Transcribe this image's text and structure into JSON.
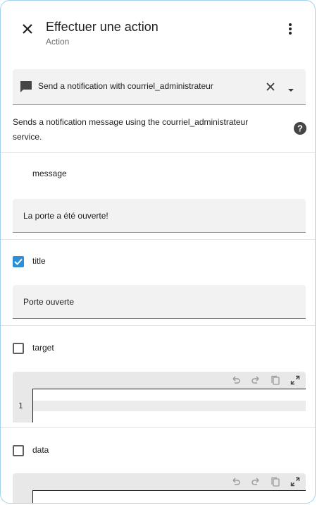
{
  "header": {
    "title": "Effectuer une action",
    "subtitle": "Action",
    "close_icon": "close-icon",
    "menu_icon": "kebab-menu-icon"
  },
  "service_picker": {
    "icon": "chat-bubble-icon",
    "value": "Send a notification with courriel_administrateur"
  },
  "description": "Sends a notification message using the courriel_administrateur service.",
  "fields": {
    "message": {
      "label": "message",
      "value": "La porte a été ouverte!",
      "checked": null
    },
    "title": {
      "label": "title",
      "value": "Porte ouverte",
      "checked": true
    },
    "target": {
      "label": "target",
      "checked": false,
      "line_number": "1"
    },
    "data": {
      "label": "data",
      "checked": false
    }
  },
  "colors": {
    "accent": "#2f8fd5",
    "field_bg": "#f2f2f2",
    "code_bg": "#e8e8e8"
  }
}
